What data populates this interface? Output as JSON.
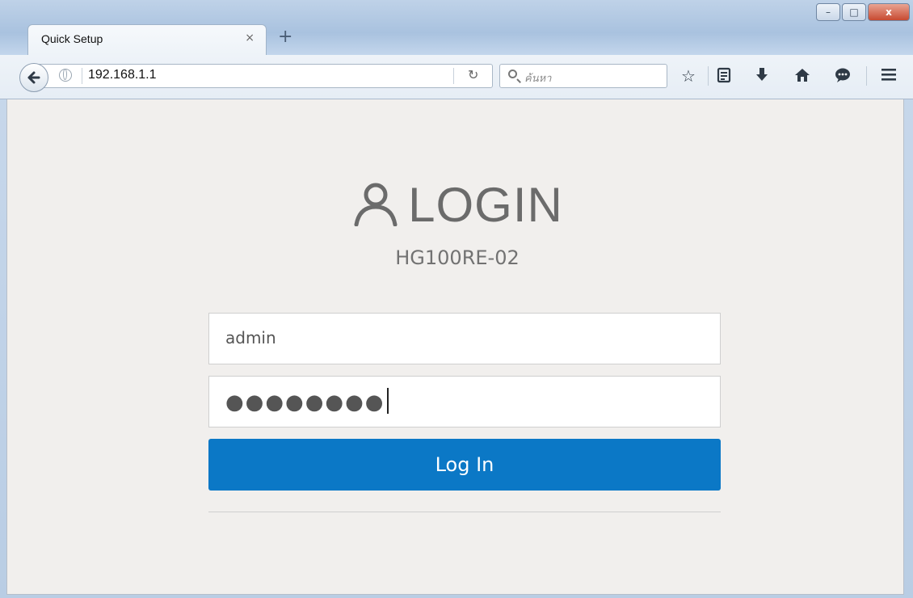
{
  "browser": {
    "tab_title": "Quick Setup",
    "tab_close_glyph": "×",
    "new_tab_glyph": "+",
    "url": "192.168.1.1",
    "search_placeholder": "ค้นหา",
    "window_buttons": {
      "minimize": "–",
      "maximize": "□",
      "close": "x"
    }
  },
  "toolbar_icons": [
    "star-icon",
    "reading-list-icon",
    "download-icon",
    "home-icon",
    "chat-icon",
    "menu-icon"
  ],
  "login": {
    "heading": "LOGIN",
    "model": "HG100RE-02",
    "username_value": "admin",
    "password_mask": "●●●●●●●●",
    "button_label": "Log In"
  },
  "colors": {
    "accent": "#0b78c6",
    "page_background": "#f1efed",
    "heading_text": "#6b6b6b"
  }
}
